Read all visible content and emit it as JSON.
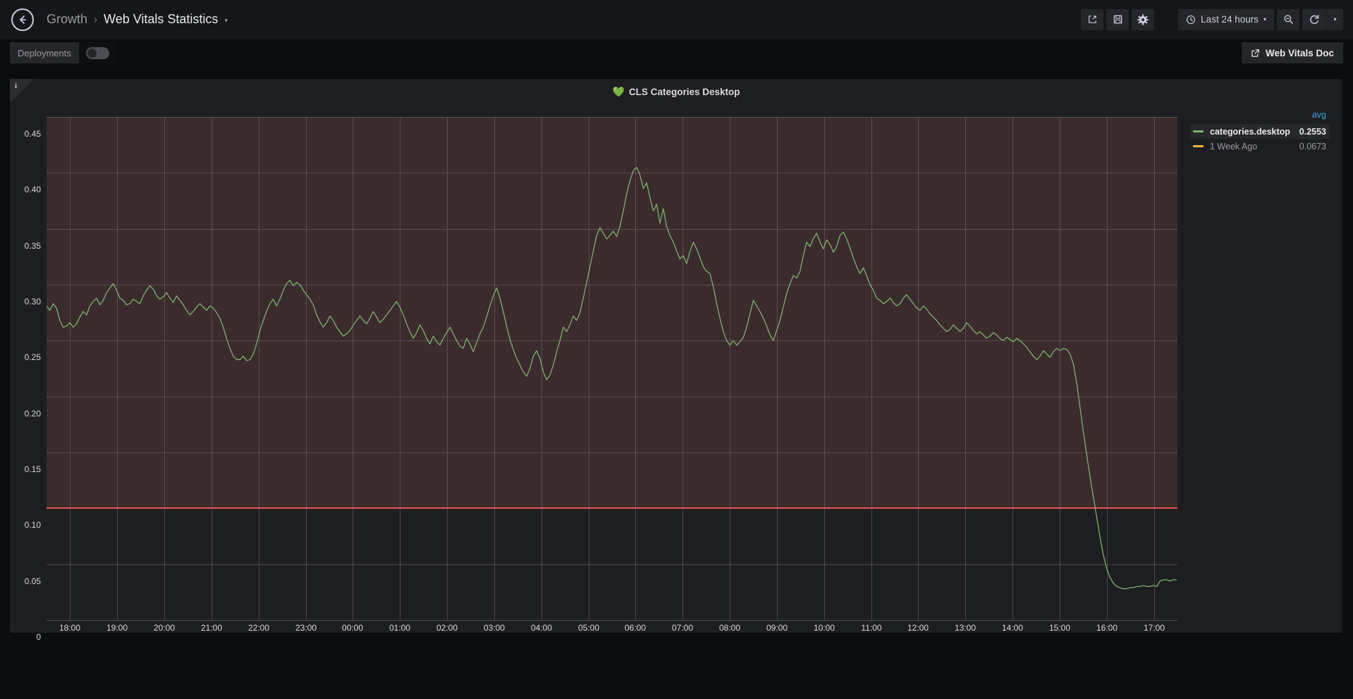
{
  "navbar": {
    "back_icon": "arrow-left-circle-icon",
    "breadcrumb_parent": "Growth",
    "breadcrumb_separator": "›",
    "breadcrumb_current": "Web Vitals Statistics",
    "breadcrumb_caret": "▾",
    "share_icon": "share-icon",
    "save_icon": "save-icon",
    "settings_icon": "gear-icon",
    "time_clock_icon": "clock-icon",
    "time_range": "Last 24 hours",
    "time_caret": "▾",
    "zoom_out_icon": "zoom-out-icon",
    "refresh_icon": "refresh-icon",
    "refresh_caret": "▾"
  },
  "subbar": {
    "variable_label": "Deployments",
    "variable_toggle_on": false,
    "doc_link_icon": "external-link-icon",
    "doc_link_label": "Web Vitals Doc"
  },
  "panel": {
    "info_icon": "info-icon",
    "title_icon": "green-heart-icon",
    "title_emoji": "💚",
    "title": "CLS Categories Desktop"
  },
  "legend": {
    "stat_header": "avg",
    "rows": [
      {
        "name": "categories.desktop",
        "value": "0.2553",
        "color": "#7eb26d",
        "selected": true
      },
      {
        "name": "1 Week Ago",
        "value": "0.0673",
        "color": "#eab839",
        "selected": false
      }
    ]
  },
  "colors": {
    "series_green": "#7eb26d",
    "series_yellow": "#eab839",
    "threshold_red": "#e5574f",
    "threshold_region": "#3b2b2d",
    "panel_bg": "#1d1e21",
    "legend_accent": "#3ca2e0"
  },
  "chart_data": {
    "type": "line",
    "title": "CLS Categories Desktop",
    "xlabel": "",
    "ylabel": "",
    "ylim": [
      0,
      0.45
    ],
    "grid": true,
    "legend_position": "right",
    "y_ticks": [
      "0",
      "0.05",
      "0.10",
      "0.15",
      "0.20",
      "0.25",
      "0.30",
      "0.35",
      "0.40",
      "0.45"
    ],
    "y_tick_values": [
      0,
      0.05,
      0.1,
      0.15,
      0.2,
      0.25,
      0.3,
      0.35,
      0.4,
      0.45
    ],
    "x_ticks": [
      "18:00",
      "19:00",
      "20:00",
      "21:00",
      "22:00",
      "23:00",
      "00:00",
      "01:00",
      "02:00",
      "03:00",
      "04:00",
      "05:00",
      "06:00",
      "07:00",
      "08:00",
      "09:00",
      "10:00",
      "11:00",
      "12:00",
      "13:00",
      "14:00",
      "15:00",
      "16:00",
      "17:00"
    ],
    "threshold": {
      "value": 0.1,
      "color": "#e5574f",
      "region_above": true
    },
    "series": [
      {
        "name": "categories.desktop",
        "color": "#7eb26d",
        "avg": 0.2553,
        "values": [
          0.281,
          0.277,
          0.283,
          0.279,
          0.268,
          0.262,
          0.263,
          0.266,
          0.262,
          0.265,
          0.271,
          0.276,
          0.273,
          0.281,
          0.285,
          0.288,
          0.282,
          0.286,
          0.293,
          0.297,
          0.301,
          0.295,
          0.288,
          0.286,
          0.282,
          0.283,
          0.287,
          0.285,
          0.283,
          0.29,
          0.295,
          0.299,
          0.296,
          0.29,
          0.287,
          0.289,
          0.293,
          0.288,
          0.284,
          0.29,
          0.286,
          0.282,
          0.277,
          0.273,
          0.276,
          0.28,
          0.283,
          0.28,
          0.277,
          0.281,
          0.279,
          0.275,
          0.27,
          0.262,
          0.252,
          0.243,
          0.236,
          0.233,
          0.233,
          0.236,
          0.232,
          0.233,
          0.238,
          0.247,
          0.259,
          0.268,
          0.276,
          0.283,
          0.287,
          0.281,
          0.287,
          0.295,
          0.301,
          0.304,
          0.299,
          0.302,
          0.3,
          0.295,
          0.291,
          0.287,
          0.282,
          0.273,
          0.267,
          0.262,
          0.266,
          0.272,
          0.268,
          0.262,
          0.258,
          0.254,
          0.256,
          0.259,
          0.264,
          0.268,
          0.272,
          0.268,
          0.265,
          0.27,
          0.276,
          0.271,
          0.266,
          0.269,
          0.273,
          0.277,
          0.281,
          0.285,
          0.28,
          0.273,
          0.265,
          0.258,
          0.252,
          0.257,
          0.264,
          0.259,
          0.252,
          0.247,
          0.254,
          0.249,
          0.246,
          0.252,
          0.257,
          0.262,
          0.256,
          0.25,
          0.245,
          0.243,
          0.252,
          0.247,
          0.24,
          0.248,
          0.256,
          0.262,
          0.271,
          0.281,
          0.29,
          0.297,
          0.288,
          0.276,
          0.263,
          0.251,
          0.242,
          0.234,
          0.228,
          0.222,
          0.218,
          0.225,
          0.236,
          0.241,
          0.234,
          0.222,
          0.215,
          0.219,
          0.228,
          0.24,
          0.25,
          0.262,
          0.258,
          0.264,
          0.272,
          0.268,
          0.275,
          0.288,
          0.302,
          0.316,
          0.33,
          0.344,
          0.351,
          0.346,
          0.341,
          0.344,
          0.348,
          0.343,
          0.352,
          0.366,
          0.381,
          0.393,
          0.402,
          0.405,
          0.398,
          0.386,
          0.391,
          0.378,
          0.366,
          0.372,
          0.355,
          0.368,
          0.352,
          0.344,
          0.338,
          0.33,
          0.323,
          0.326,
          0.319,
          0.33,
          0.338,
          0.332,
          0.324,
          0.316,
          0.312,
          0.31,
          0.298,
          0.283,
          0.27,
          0.258,
          0.25,
          0.246,
          0.25,
          0.246,
          0.249,
          0.253,
          0.262,
          0.274,
          0.286,
          0.281,
          0.276,
          0.27,
          0.263,
          0.255,
          0.25,
          0.259,
          0.268,
          0.28,
          0.292,
          0.301,
          0.308,
          0.306,
          0.312,
          0.326,
          0.338,
          0.334,
          0.341,
          0.346,
          0.338,
          0.332,
          0.34,
          0.336,
          0.329,
          0.334,
          0.344,
          0.347,
          0.341,
          0.333,
          0.324,
          0.316,
          0.31,
          0.315,
          0.308,
          0.3,
          0.295,
          0.288,
          0.286,
          0.283,
          0.285,
          0.288,
          0.284,
          0.281,
          0.283,
          0.288,
          0.291,
          0.287,
          0.283,
          0.279,
          0.277,
          0.281,
          0.278,
          0.274,
          0.271,
          0.268,
          0.264,
          0.261,
          0.258,
          0.26,
          0.264,
          0.261,
          0.258,
          0.261,
          0.266,
          0.263,
          0.259,
          0.256,
          0.258,
          0.255,
          0.252,
          0.254,
          0.257,
          0.255,
          0.252,
          0.25,
          0.253,
          0.251,
          0.249,
          0.252,
          0.25,
          0.247,
          0.244,
          0.24,
          0.236,
          0.233,
          0.236,
          0.241,
          0.238,
          0.235,
          0.24,
          0.243,
          0.241,
          0.243,
          0.242,
          0.238,
          0.229,
          0.212,
          0.19,
          0.168,
          0.148,
          0.128,
          0.11,
          0.092,
          0.074,
          0.058,
          0.046,
          0.038,
          0.033,
          0.03,
          0.029,
          0.028,
          0.028,
          0.029,
          0.029,
          0.03,
          0.03,
          0.031,
          0.03,
          0.03,
          0.031,
          0.03,
          0.035,
          0.036,
          0.036,
          0.035,
          0.036,
          0.036
        ]
      },
      {
        "name": "1 Week Ago",
        "color": "#eab839",
        "avg": 0.0673,
        "values": []
      }
    ]
  }
}
